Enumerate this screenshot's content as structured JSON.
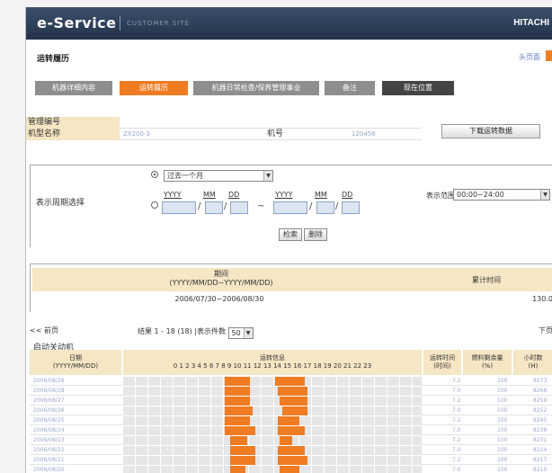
{
  "header": {
    "logo": "e-Service",
    "subtitle": "CUSTOMER SITE",
    "brand": "HITACHI"
  },
  "page": {
    "title": "运转履历",
    "home_link": "头页面"
  },
  "tabs": [
    {
      "label": "机器详细内容"
    },
    {
      "label": "运转履历"
    },
    {
      "label": "机器日常检查/保养管理事业"
    },
    {
      "label": "备注"
    },
    {
      "label": "现在位置"
    }
  ],
  "info": {
    "mgmt_label": "管理编号",
    "model_label": "机型名称",
    "model_value": "ZX200-3",
    "serial_label": "机号",
    "serial_value": "120456",
    "download_button": "下载运转数据"
  },
  "period": {
    "label": "表示周期选择",
    "preset_value": "过去一个月",
    "yyyy": "YYYY",
    "mm": "MM",
    "dd": "DD",
    "tilde": "~",
    "range_label": "表示范围",
    "range_value": "00:00~24:00",
    "search_button": "检索",
    "clear_button": "删除"
  },
  "summary": {
    "period_head": "期间",
    "period_format": "(YYYY/MM/DD~YYYY/MM/DD)",
    "total_head": "累计时间",
    "period_value": "2006/07/30~2006/08/30",
    "total_value": "130.0"
  },
  "pager": {
    "prev": "<< 前页",
    "result": "结果 1 - 18 (18) |表示件数",
    "per_page": "50",
    "next": "下页"
  },
  "table": {
    "title": "启动关动机",
    "col_date": "日期",
    "col_date_fmt": "(YYYY/MM/DD)",
    "col_run": "运转信息",
    "col_hours": "0 1 2 3 4 5 6 7 8 9 10 11 12 13 14 15 16 17 18 19 20 21 22 23",
    "col_time": "运转时间",
    "col_time_unit": "(时间)",
    "col_fuel": "燃料剩余量",
    "col_fuel_unit": "(%)",
    "col_hourmeter": "小时数",
    "col_hourmeter_unit": "(H)",
    "rows": [
      {
        "date": "2006/08/29",
        "time": "7.2",
        "fuel": "100",
        "hm": "8273",
        "segs": [
          [
            8.2,
            10.2
          ],
          [
            12.2,
            14.6
          ]
        ]
      },
      {
        "date": "2006/08/28",
        "time": "7.0",
        "fuel": "100",
        "hm": "8266",
        "segs": [
          [
            8.2,
            10.2
          ],
          [
            12.4,
            14.8
          ]
        ]
      },
      {
        "date": "2006/08/27",
        "time": "7.2",
        "fuel": "100",
        "hm": "8259",
        "segs": [
          [
            8.2,
            10.2
          ],
          [
            12.6,
            14.8
          ]
        ]
      },
      {
        "date": "2006/08/26",
        "time": "7.0",
        "fuel": "100",
        "hm": "8252",
        "segs": [
          [
            8.2,
            10.4
          ],
          [
            12.8,
            14.8
          ]
        ]
      },
      {
        "date": "2006/08/25",
        "time": "7.2",
        "fuel": "100",
        "hm": "8245",
        "segs": [
          [
            8.2,
            10.2
          ],
          [
            12.4,
            14.2
          ]
        ]
      },
      {
        "date": "2006/08/24",
        "time": "7.0",
        "fuel": "100",
        "hm": "8238",
        "segs": [
          [
            8.2,
            10.6
          ],
          [
            12.4,
            14.6
          ]
        ]
      },
      {
        "date": "2006/08/23",
        "time": "7.2",
        "fuel": "100",
        "hm": "8231",
        "segs": [
          [
            8.6,
            10.0
          ],
          [
            12.6,
            13.6
          ]
        ]
      },
      {
        "date": "2006/08/22",
        "time": "7.0",
        "fuel": "100",
        "hm": "8224",
        "segs": [
          [
            8.6,
            10.6
          ],
          [
            12.4,
            14.6
          ]
        ]
      },
      {
        "date": "2006/08/21",
        "time": "7.2",
        "fuel": "100",
        "hm": "8217",
        "segs": [
          [
            8.6,
            10.6
          ],
          [
            12.4,
            14.8
          ]
        ]
      },
      {
        "date": "2006/08/20",
        "time": "7.0",
        "fuel": "100",
        "hm": "8210",
        "segs": [
          [
            8.6,
            9.8
          ],
          [
            12.6,
            14.2
          ]
        ]
      }
    ]
  }
}
